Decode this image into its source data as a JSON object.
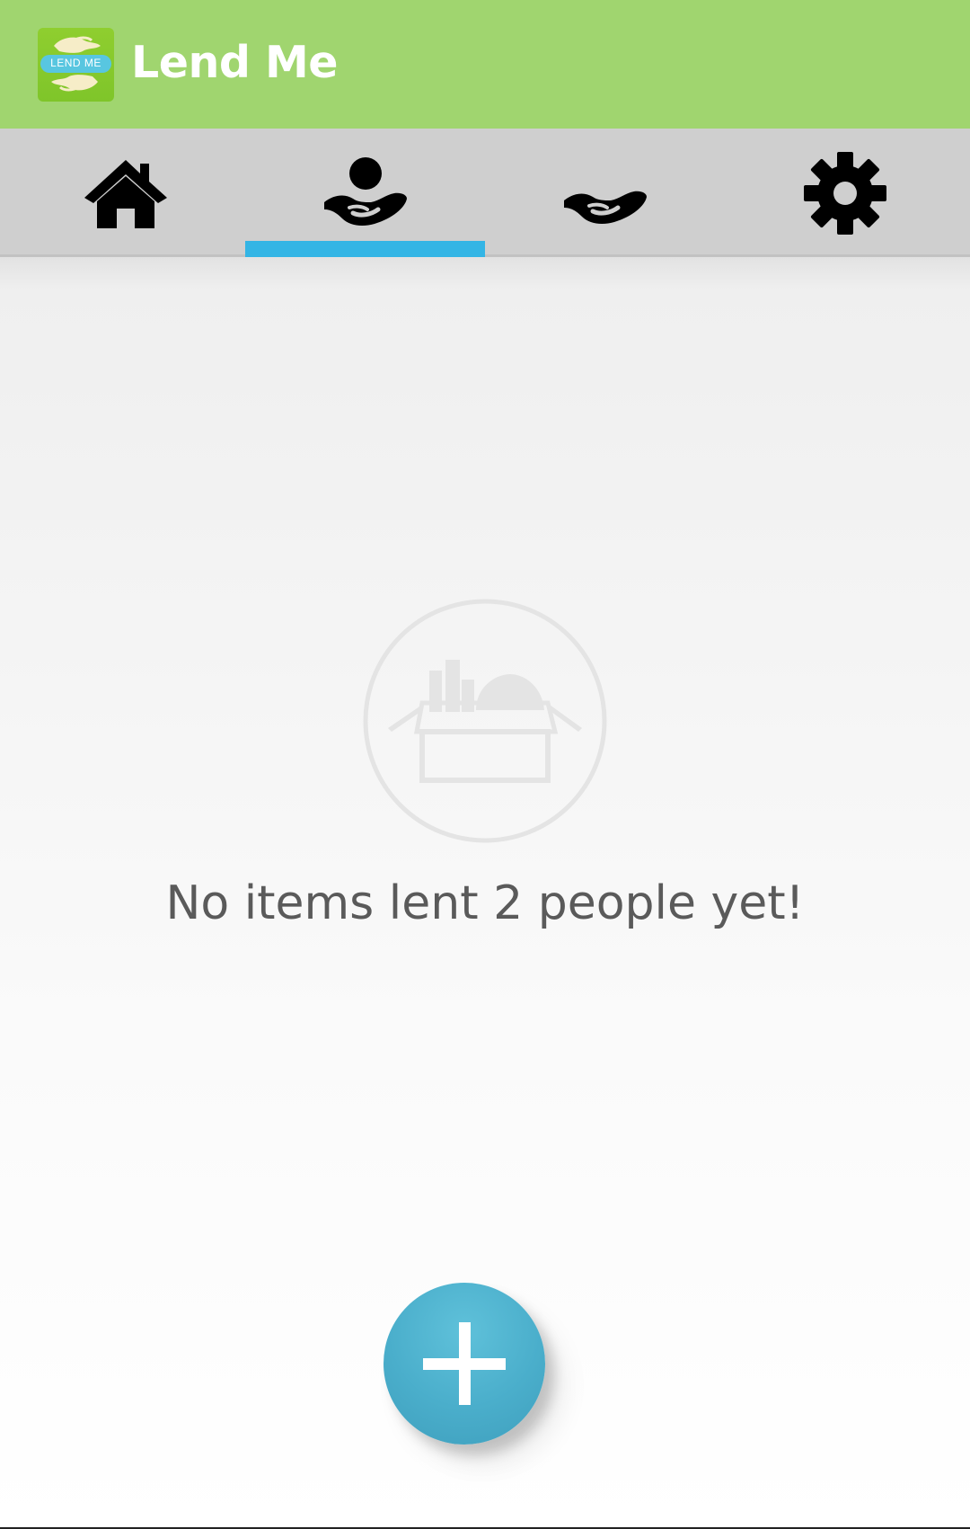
{
  "app_bar": {
    "title": "Lend Me",
    "logo_text": "LEND ME",
    "logo_icon": "lend-me-hands-logo"
  },
  "tabs": [
    {
      "name": "home",
      "icon": "home-icon",
      "selected": false
    },
    {
      "name": "lent",
      "icon": "hand-giving-person-icon",
      "selected": true
    },
    {
      "name": "borrowed",
      "icon": "open-hand-icon",
      "selected": false
    },
    {
      "name": "settings",
      "icon": "gear-icon",
      "selected": false
    }
  ],
  "empty_state": {
    "icon": "open-box-icon",
    "message": "No items lent 2 people yet!"
  },
  "fab": {
    "icon": "plus-icon"
  },
  "colors": {
    "app_bar": "#a0d56f",
    "tab_bar": "#cfcfcf",
    "tab_indicator": "#33b5e5",
    "fab": "#4aaecb",
    "message_text": "#5a5a5a"
  }
}
